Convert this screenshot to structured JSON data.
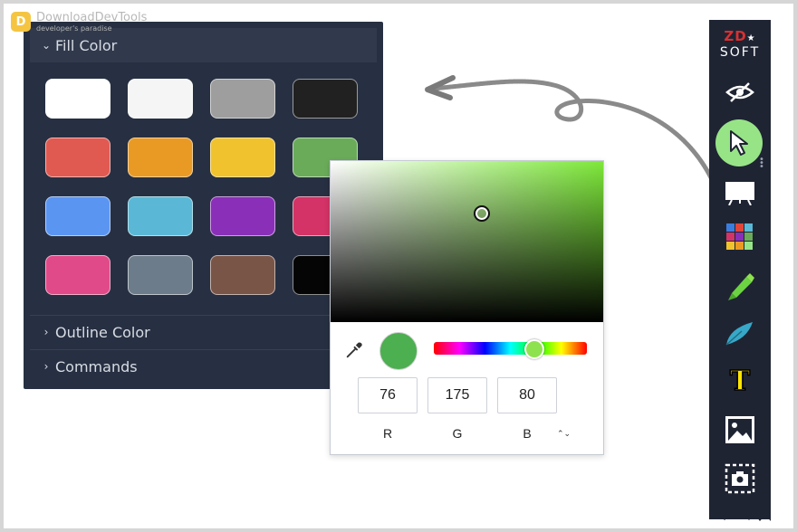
{
  "watermark": {
    "title": "DownloadDevTools",
    "subtitle": "developer's paradise",
    "logo_glyph": "D"
  },
  "panel": {
    "fill_section": {
      "chevron": "⌄",
      "label": "Fill Color"
    },
    "swatches": [
      {
        "color": "#ffffff"
      },
      {
        "color": "#f5f5f5"
      },
      {
        "color": "#9e9e9e"
      },
      {
        "color": "#212121"
      },
      {
        "color": "#e05a52"
      },
      {
        "color": "#e99a25"
      },
      {
        "color": "#f0c22e"
      },
      {
        "color": "#6aab5a"
      },
      {
        "color": "#5b95f2"
      },
      {
        "color": "#5ab8d6"
      },
      {
        "color": "#8a2fb8"
      },
      {
        "color": "#d33366"
      },
      {
        "color": "#e04a88"
      },
      {
        "color": "#6d7c8a"
      },
      {
        "color": "#795548"
      },
      {
        "color": "#050505"
      }
    ],
    "outline_section": {
      "chevron": "›",
      "label": "Outline Color"
    },
    "commands_section": {
      "chevron": "›",
      "label": "Commands"
    }
  },
  "picker": {
    "preview_color": "#4caf50",
    "hue_knob_color": "#8ee24f",
    "eyedropper_icon": "eyedropper-icon",
    "fields": [
      {
        "label": "R",
        "value": "76"
      },
      {
        "label": "G",
        "value": "175"
      },
      {
        "label": "B",
        "value": "80"
      }
    ],
    "mode_toggle": "⌃⌄"
  },
  "toolbar": {
    "logo_top": "ZD",
    "logo_star": "★",
    "logo_bottom": "SOFT",
    "tools": [
      {
        "name": "hide-icon"
      },
      {
        "name": "pointer-icon",
        "active": true
      },
      {
        "name": "whiteboard-icon"
      },
      {
        "name": "color-palette-icon"
      },
      {
        "name": "highlighter-icon"
      },
      {
        "name": "pen-icon"
      },
      {
        "name": "text-icon",
        "glyph": "T"
      },
      {
        "name": "image-icon"
      },
      {
        "name": "screenshot-icon"
      }
    ]
  },
  "colors": {
    "panel_bg": "#273042",
    "toolbar_bg": "#1f2433",
    "active_tool": "#97e487"
  }
}
